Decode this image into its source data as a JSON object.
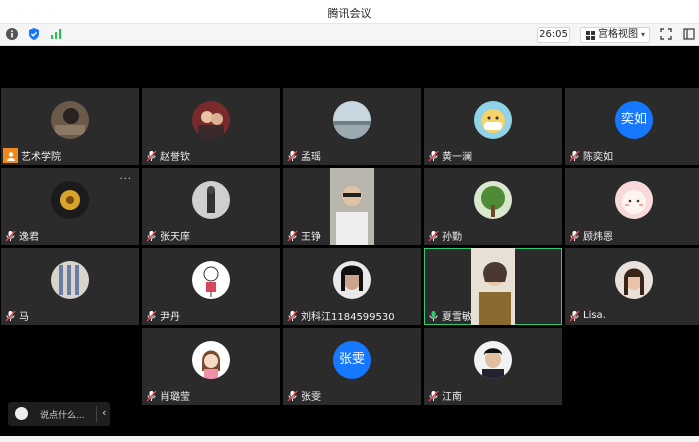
{
  "window": {
    "title": "腾讯会议"
  },
  "toolbar": {
    "timer": "26:05",
    "view_label": "宫格视图"
  },
  "chat": {
    "placeholder": "说点什么..."
  },
  "participants": [
    {
      "name": "艺术学院",
      "avatar": "photo"
    },
    {
      "name": "赵誉钦",
      "avatar": "photo"
    },
    {
      "name": "孟瑶",
      "avatar": "photo"
    },
    {
      "name": "黄一澜",
      "avatar": "photo"
    },
    {
      "name": "陈奕如",
      "avatar": "text",
      "initials": "奕如"
    },
    {
      "name": "逸君",
      "avatar": "photo"
    },
    {
      "name": "张天庠",
      "avatar": "photo"
    },
    {
      "name": "王铮",
      "avatar": "video"
    },
    {
      "name": "孙勤",
      "avatar": "photo"
    },
    {
      "name": "顾炜恩",
      "avatar": "photo"
    },
    {
      "name": "马",
      "avatar": "photo"
    },
    {
      "name": "尹丹",
      "avatar": "photo"
    },
    {
      "name": "刘科江1184599530",
      "avatar": "photo"
    },
    {
      "name": "夏雪敏",
      "avatar": "video"
    },
    {
      "name": "Lisa.",
      "avatar": "photo"
    },
    {
      "name": "肖璐莹",
      "avatar": "photo"
    },
    {
      "name": "张雯",
      "avatar": "text",
      "initials": "张雯"
    },
    {
      "name": "江南",
      "avatar": "photo"
    }
  ],
  "colors": {
    "accent": "#1677ff",
    "host_badge": "#f08a1c",
    "speaking": "#2ecc71"
  }
}
